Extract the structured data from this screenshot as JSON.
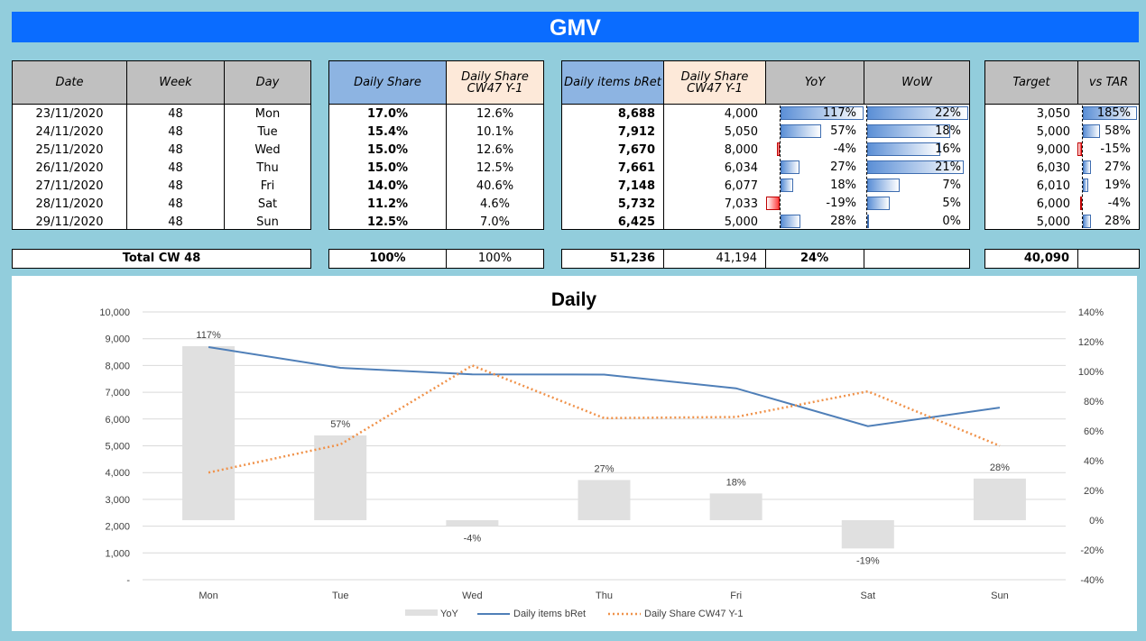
{
  "title": "GMV",
  "table": {
    "headers": {
      "date": "Date",
      "week": "Week",
      "day": "Day",
      "daily_share": "Daily Share",
      "daily_share_cw47_l1": "Daily Share",
      "daily_share_cw47_l2": "CW47   Y-1",
      "daily_items": "Daily items bRet",
      "daily_share_cw47_b_l1": "Daily Share",
      "daily_share_cw47_b_l2": "CW47   Y-1",
      "yoy": "YoY",
      "wow": "WoW",
      "target": "Target",
      "vs_tar": "vs TAR"
    },
    "rows": [
      {
        "date": "23/11/2020",
        "week": "48",
        "day": "Mon",
        "share": "17.0%",
        "share_py": "12.6%",
        "items": "8,688",
        "items_py": "4,000",
        "yoy": "117%",
        "yoy_v": 117,
        "wow": "22%",
        "wow_v": 22,
        "target": "3,050",
        "vstar": "185%",
        "vstar_v": 185
      },
      {
        "date": "24/11/2020",
        "week": "48",
        "day": "Tue",
        "share": "15.4%",
        "share_py": "10.1%",
        "items": "7,912",
        "items_py": "5,050",
        "yoy": "57%",
        "yoy_v": 57,
        "wow": "18%",
        "wow_v": 18,
        "target": "5,000",
        "vstar": "58%",
        "vstar_v": 58
      },
      {
        "date": "25/11/2020",
        "week": "48",
        "day": "Wed",
        "share": "15.0%",
        "share_py": "12.6%",
        "items": "7,670",
        "items_py": "8,000",
        "yoy": "-4%",
        "yoy_v": -4,
        "wow": "16%",
        "wow_v": 16,
        "target": "9,000",
        "vstar": "-15%",
        "vstar_v": -15
      },
      {
        "date": "26/11/2020",
        "week": "48",
        "day": "Thu",
        "share": "15.0%",
        "share_py": "12.5%",
        "items": "7,661",
        "items_py": "6,034",
        "yoy": "27%",
        "yoy_v": 27,
        "wow": "21%",
        "wow_v": 21,
        "target": "6,030",
        "vstar": "27%",
        "vstar_v": 27
      },
      {
        "date": "27/11/2020",
        "week": "48",
        "day": "Fri",
        "share": "14.0%",
        "share_py": "40.6%",
        "items": "7,148",
        "items_py": "6,077",
        "yoy": "18%",
        "yoy_v": 18,
        "wow": "7%",
        "wow_v": 7,
        "target": "6,010",
        "vstar": "19%",
        "vstar_v": 19
      },
      {
        "date": "28/11/2020",
        "week": "48",
        "day": "Sat",
        "share": "11.2%",
        "share_py": "4.6%",
        "items": "5,732",
        "items_py": "7,033",
        "yoy": "-19%",
        "yoy_v": -19,
        "wow": "5%",
        "wow_v": 5,
        "target": "6,000",
        "vstar": "-4%",
        "vstar_v": -4
      },
      {
        "date": "29/11/2020",
        "week": "48",
        "day": "Sun",
        "share": "12.5%",
        "share_py": "7.0%",
        "items": "6,425",
        "items_py": "5,000",
        "yoy": "28%",
        "yoy_v": 28,
        "wow": "0%",
        "wow_v": 0,
        "target": "5,000",
        "vstar": "28%",
        "vstar_v": 28
      }
    ],
    "totals": {
      "label": "Total CW 48",
      "share": "100%",
      "share_py": "100%",
      "items": "51,236",
      "items_py": "41,194",
      "yoy": "24%",
      "target": "40,090"
    }
  },
  "colors": {
    "banner": "#0a6cff",
    "background": "#92cddc",
    "bar_positive": "#5b8fd6",
    "bar_negative": "#ff3b3b",
    "line_items": "#4f7fb8",
    "line_share": "#f0924a",
    "yoy_bar": "#e0e0e0"
  },
  "chart_data": {
    "type": "bar+line",
    "title": "Daily",
    "categories": [
      "Mon",
      "Tue",
      "Wed",
      "Thu",
      "Fri",
      "Sat",
      "Sun"
    ],
    "left_ticks": [
      "10,000",
      "9,000",
      "8,000",
      "7,000",
      "6,000",
      "5,000",
      "4,000",
      "3,000",
      "2,000",
      "1,000",
      "-"
    ],
    "right_ticks": [
      "140%",
      "120%",
      "100%",
      "80%",
      "60%",
      "40%",
      "20%",
      "0%",
      "-20%",
      "-40%"
    ],
    "left_ylim": [
      0,
      10000
    ],
    "right_ylim": [
      -40,
      140
    ],
    "series": [
      {
        "name": "YoY",
        "type": "bar",
        "axis": "right",
        "values": [
          117,
          57,
          -4,
          27,
          18,
          -19,
          28
        ],
        "labels": [
          "117%",
          "57%",
          "-4%",
          "27%",
          "18%",
          "-19%",
          "28%"
        ]
      },
      {
        "name": "Daily items bRet",
        "type": "line",
        "axis": "left",
        "values": [
          8688,
          7912,
          7670,
          7661,
          7148,
          5732,
          6425
        ]
      },
      {
        "name": "Daily Share CW47   Y-1",
        "type": "line-dotted",
        "axis": "left",
        "values": [
          4000,
          5050,
          8000,
          6034,
          6077,
          7033,
          5000
        ]
      }
    ],
    "legend_position": "bottom",
    "grid": true
  }
}
